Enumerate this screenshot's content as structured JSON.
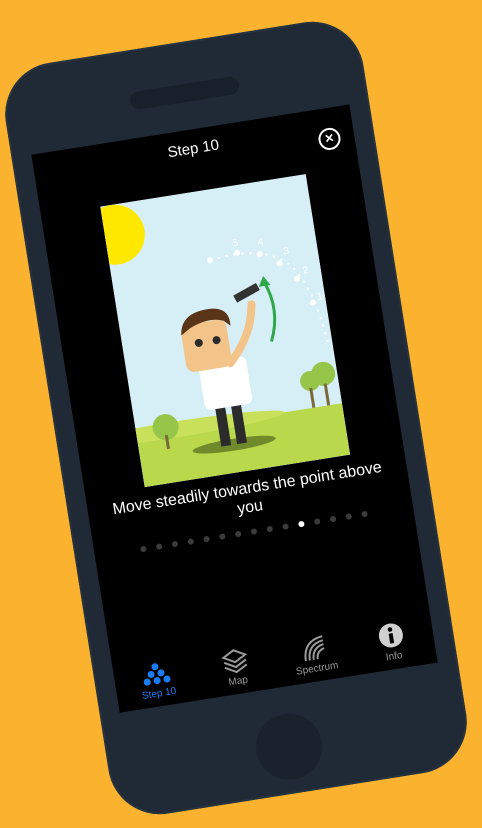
{
  "header": {
    "title": "Step 10",
    "close_icon": "close-circle-icon"
  },
  "illustration": {
    "arc_numbers": [
      "5",
      "4",
      "3",
      "2",
      "1"
    ],
    "scene": "man pointing device up along dotted arc; sun, trees, grass"
  },
  "instruction": "Move steadily towards the point above you",
  "pagination": {
    "total": 15,
    "active_index": 10
  },
  "tabs": [
    {
      "label": "Step 10",
      "icon": "step-dots-icon",
      "active": true
    },
    {
      "label": "Map",
      "icon": "layers-icon",
      "active": false
    },
    {
      "label": "Spectrum",
      "icon": "spectrum-icon",
      "active": false
    },
    {
      "label": "Info",
      "icon": "info-icon",
      "active": false
    }
  ],
  "colors": {
    "background": "#FBB32F",
    "phone": "#1F2A36",
    "accent": "#1A7CF5"
  }
}
